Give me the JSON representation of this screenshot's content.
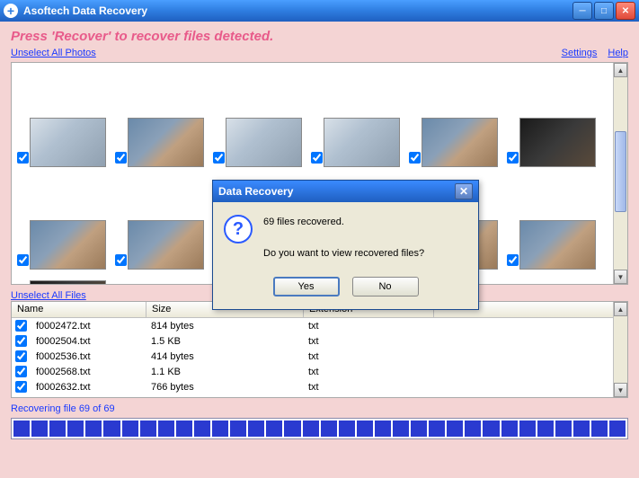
{
  "window": {
    "title": "Asoftech Data Recovery"
  },
  "instruction": "Press 'Recover' to recover files detected.",
  "links": {
    "unselect_photos": "Unselect All Photos",
    "unselect_files": "Unselect All Files",
    "settings": "Settings",
    "help": "Help"
  },
  "file_table": {
    "headers": {
      "name": "Name",
      "size": "Size",
      "ext": "Extension"
    },
    "rows": [
      {
        "name": "f0002472.txt",
        "size": "814 bytes",
        "ext": "txt"
      },
      {
        "name": "f0002504.txt",
        "size": "1.5 KB",
        "ext": "txt"
      },
      {
        "name": "f0002536.txt",
        "size": "414 bytes",
        "ext": "txt"
      },
      {
        "name": "f0002568.txt",
        "size": "1.1 KB",
        "ext": "txt"
      },
      {
        "name": "f0002632.txt",
        "size": "766 bytes",
        "ext": "txt"
      }
    ]
  },
  "status": "Recovering file 69 of 69",
  "dialog": {
    "title": "Data Recovery",
    "line1": "69 files recovered.",
    "line2": "Do you want to view recovered files?",
    "yes": "Yes",
    "no": "No"
  }
}
